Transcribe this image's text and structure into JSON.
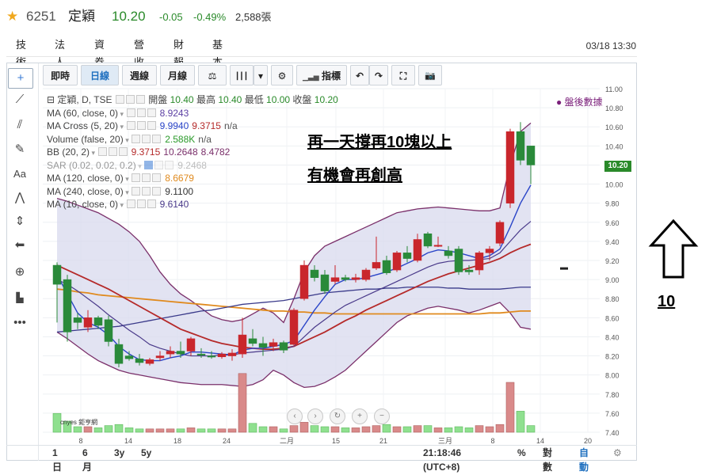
{
  "header": {
    "code": "6251",
    "name": "定穎",
    "price": "10.20",
    "change": "-0.05",
    "change_pct": "-0.49%",
    "volume": "2,588張",
    "star": "★"
  },
  "tabs": [
    "技術",
    "法人",
    "資券",
    "營收",
    "財報",
    "基本"
  ],
  "datetime": "03/18 13:30",
  "toolbar": {
    "items": [
      "即時",
      "日線",
      "週線",
      "月線",
      "⚖",
      "┃┃┃",
      "▾",
      "⚙",
      "指標",
      "↶",
      "↷",
      "⛶",
      "📷"
    ]
  },
  "legend": {
    "title": "定穎, D, TSE",
    "ohlc_open_label": "開盤",
    "ohlc_open": "10.40",
    "ohlc_high_label": "最高",
    "ohlc_high": "10.40",
    "ohlc_low_label": "最低",
    "ohlc_low": "10.00",
    "ohlc_close_label": "收盤",
    "ohlc_close": "10.20",
    "rows": [
      {
        "label": "MA (60, close, 0)",
        "values": [
          "8.9243"
        ],
        "colors": [
          "#5b3fa3"
        ]
      },
      {
        "label": "MA Cross (5, 20)",
        "values": [
          "9.9940",
          "9.3715",
          "n/a"
        ],
        "colors": [
          "#2a45c8",
          "#b52a2a",
          "#555555"
        ]
      },
      {
        "label": "Volume (false, 20)",
        "values": [
          "2.588K",
          "n/a"
        ],
        "colors": [
          "#2a9a2a",
          "#555555"
        ]
      },
      {
        "label": "BB (20, 2)",
        "values": [
          "9.3715",
          "10.2648",
          "8.4782"
        ],
        "colors": [
          "#b52a2a",
          "#7a2f6a",
          "#7a2f6a"
        ]
      },
      {
        "label": "SAR (0.02, 0.02, 0.2)",
        "values": [
          "9.2468"
        ],
        "colors": [
          "#888888"
        ]
      },
      {
        "label": "MA (120, close, 0)",
        "values": [
          "8.6679"
        ],
        "colors": [
          "#e08a1e"
        ]
      },
      {
        "label": "MA (240, close, 0)",
        "values": [
          "9.1100"
        ],
        "colors": [
          "#333333"
        ]
      },
      {
        "label": "MA (10, close, 0)",
        "values": [
          "9.6140"
        ],
        "colors": [
          "#4a3a8a"
        ]
      }
    ]
  },
  "after_hours": "盤後數據",
  "annotations": {
    "line1": "再一天撐再10塊以上",
    "line2": "有機會再創高",
    "arrow_label": "10"
  },
  "price_tag": "10.20",
  "bottom_bar": {
    "ranges": [
      "1日",
      "6月",
      "3y",
      "5y"
    ],
    "time": "21:18:46 (UTC+8)",
    "pct": "%",
    "log": "對數",
    "auto": "自動",
    "gear": "⚙"
  },
  "watermark": "cnyes 鉅亨網",
  "colors": {
    "up": "#c9262c",
    "down": "#2a8a3a",
    "bb_fill": "#d8daee",
    "bb_line": "#7a2f6a",
    "ma5": "#2a45c8",
    "ma20": "#b52a2a",
    "ma120": "#e08a1e",
    "ma60": "#3a3a8a",
    "vol_up": "#d98a8a",
    "vol_down": "#8fe08f"
  },
  "chart_data": {
    "type": "candlestick",
    "y_axis": {
      "ticks": [
        "11.00",
        "10.80",
        "10.60",
        "10.40",
        "10.20",
        "10.00",
        "9.80",
        "9.60",
        "9.40",
        "9.20",
        "9.00",
        "8.80",
        "8.60",
        "8.40",
        "8.20",
        "8.00",
        "7.80",
        "7.60",
        "7.40"
      ],
      "ylim": [
        7.4,
        11.0
      ]
    },
    "x_axis": {
      "ticks": [
        "8",
        "14",
        "18",
        "24",
        "二月",
        "15",
        "21",
        "三月",
        "8",
        "14",
        "20"
      ]
    },
    "candles": [
      {
        "o": 9.15,
        "h": 9.18,
        "l": 8.55,
        "c": 8.95
      },
      {
        "o": 9.0,
        "h": 9.05,
        "l": 8.35,
        "c": 8.45
      },
      {
        "o": 8.6,
        "h": 8.65,
        "l": 8.48,
        "c": 8.55
      },
      {
        "o": 8.5,
        "h": 8.68,
        "l": 8.45,
        "c": 8.6
      },
      {
        "o": 8.6,
        "h": 8.62,
        "l": 8.48,
        "c": 8.52
      },
      {
        "o": 8.58,
        "h": 8.62,
        "l": 8.3,
        "c": 8.35
      },
      {
        "o": 8.32,
        "h": 8.38,
        "l": 8.08,
        "c": 8.12
      },
      {
        "o": 8.2,
        "h": 8.25,
        "l": 8.15,
        "c": 8.17
      },
      {
        "o": 8.17,
        "h": 8.22,
        "l": 8.1,
        "c": 8.13
      },
      {
        "o": 8.12,
        "h": 8.18,
        "l": 8.1,
        "c": 8.16
      },
      {
        "o": 8.18,
        "h": 8.25,
        "l": 8.15,
        "c": 8.2
      },
      {
        "o": 8.22,
        "h": 8.3,
        "l": 8.18,
        "c": 8.25
      },
      {
        "o": 8.25,
        "h": 8.35,
        "l": 8.18,
        "c": 8.22
      },
      {
        "o": 8.25,
        "h": 8.4,
        "l": 8.2,
        "c": 8.38
      },
      {
        "o": 8.22,
        "h": 8.28,
        "l": 8.18,
        "c": 8.21
      },
      {
        "o": 8.2,
        "h": 8.25,
        "l": 8.17,
        "c": 8.19
      },
      {
        "o": 8.19,
        "h": 8.24,
        "l": 8.17,
        "c": 8.22
      },
      {
        "o": 8.2,
        "h": 8.27,
        "l": 8.15,
        "c": 8.23
      },
      {
        "o": 8.22,
        "h": 8.6,
        "l": 8.18,
        "c": 8.42
      },
      {
        "o": 8.38,
        "h": 8.48,
        "l": 8.3,
        "c": 8.33
      },
      {
        "o": 8.33,
        "h": 8.4,
        "l": 8.2,
        "c": 8.29
      },
      {
        "o": 8.3,
        "h": 8.38,
        "l": 8.25,
        "c": 8.34
      },
      {
        "o": 8.34,
        "h": 8.36,
        "l": 8.23,
        "c": 8.26
      },
      {
        "o": 8.32,
        "h": 8.7,
        "l": 8.3,
        "c": 8.68
      },
      {
        "o": 8.8,
        "h": 9.2,
        "l": 8.78,
        "c": 9.15
      },
      {
        "o": 9.1,
        "h": 9.15,
        "l": 8.98,
        "c": 9.02
      },
      {
        "o": 9.05,
        "h": 9.1,
        "l": 8.85,
        "c": 8.88
      },
      {
        "o": 8.98,
        "h": 9.15,
        "l": 8.95,
        "c": 9.02
      },
      {
        "o": 9.02,
        "h": 9.05,
        "l": 8.98,
        "c": 9.0
      },
      {
        "o": 9.0,
        "h": 9.06,
        "l": 8.97,
        "c": 9.02
      },
      {
        "o": 9.0,
        "h": 9.12,
        "l": 8.98,
        "c": 9.1
      },
      {
        "o": 9.12,
        "h": 9.45,
        "l": 9.1,
        "c": 9.18
      },
      {
        "o": 9.2,
        "h": 9.25,
        "l": 9.05,
        "c": 9.07
      },
      {
        "o": 9.1,
        "h": 9.3,
        "l": 9.08,
        "c": 9.28
      },
      {
        "o": 9.28,
        "h": 9.35,
        "l": 9.18,
        "c": 9.22
      },
      {
        "o": 9.2,
        "h": 9.48,
        "l": 9.18,
        "c": 9.42
      },
      {
        "o": 9.48,
        "h": 9.5,
        "l": 9.33,
        "c": 9.35
      },
      {
        "o": 9.35,
        "h": 9.45,
        "l": 9.34,
        "c": 9.36
      },
      {
        "o": 9.3,
        "h": 9.35,
        "l": 9.22,
        "c": 9.25
      },
      {
        "o": 9.32,
        "h": 9.35,
        "l": 9.05,
        "c": 9.08
      },
      {
        "o": 9.1,
        "h": 9.15,
        "l": 9.05,
        "c": 9.08
      },
      {
        "o": 9.1,
        "h": 9.3,
        "l": 9.05,
        "c": 9.28
      },
      {
        "o": 9.28,
        "h": 9.35,
        "l": 9.2,
        "c": 9.32
      },
      {
        "o": 9.38,
        "h": 9.62,
        "l": 9.35,
        "c": 9.6
      },
      {
        "o": 9.8,
        "h": 10.58,
        "l": 9.75,
        "c": 10.55
      },
      {
        "o": 10.55,
        "h": 10.65,
        "l": 10.2,
        "c": 10.25
      },
      {
        "o": 10.4,
        "h": 10.4,
        "l": 10.0,
        "c": 10.2
      }
    ],
    "volumes": [
      1.7,
      1.0,
      0.5,
      0.5,
      0.4,
      0.6,
      0.7,
      0.4,
      0.3,
      0.3,
      0.3,
      0.3,
      0.3,
      0.4,
      0.3,
      0.3,
      0.3,
      0.3,
      5.3,
      0.8,
      0.5,
      0.5,
      0.3,
      0.6,
      0.9,
      0.6,
      0.5,
      0.5,
      0.4,
      0.4,
      0.5,
      0.6,
      0.7,
      0.5,
      0.5,
      0.6,
      0.6,
      0.4,
      0.4,
      0.5,
      0.4,
      0.6,
      0.5,
      0.7,
      4.5,
      1.9,
      0.6
    ],
    "ma5": [
      9.05,
      8.85,
      8.65,
      8.55,
      8.5,
      8.42,
      8.3,
      8.22,
      8.16,
      8.15,
      8.15,
      8.18,
      8.2,
      8.24,
      8.24,
      8.23,
      8.22,
      8.21,
      8.26,
      8.28,
      8.28,
      8.3,
      8.32,
      8.36,
      8.52,
      8.68,
      8.82,
      8.95,
      9.0,
      9.0,
      9.02,
      9.05,
      9.08,
      9.12,
      9.17,
      9.22,
      9.28,
      9.31,
      9.3,
      9.28,
      9.25,
      9.22,
      9.25,
      9.32,
      9.55,
      9.8,
      9.99
    ],
    "ma20": [
      9.15,
      9.1,
      9.05,
      9.0,
      8.95,
      8.9,
      8.84,
      8.78,
      8.72,
      8.66,
      8.6,
      8.54,
      8.48,
      8.44,
      8.4,
      8.36,
      8.33,
      8.31,
      8.29,
      8.28,
      8.27,
      8.27,
      8.28,
      8.3,
      8.35,
      8.4,
      8.45,
      8.51,
      8.57,
      8.62,
      8.68,
      8.73,
      8.78,
      8.83,
      8.88,
      8.93,
      8.98,
      9.02,
      9.06,
      9.09,
      9.12,
      9.15,
      9.18,
      9.22,
      9.28,
      9.33,
      9.37
    ],
    "ma10": [
      9.0,
      8.95,
      8.88,
      8.8,
      8.72,
      8.63,
      8.55,
      8.47,
      8.4,
      8.32,
      8.28,
      8.25,
      8.22,
      8.2,
      8.2,
      8.2,
      8.21,
      8.21,
      8.23,
      8.24,
      8.25,
      8.26,
      8.27,
      8.3,
      8.4,
      8.5,
      8.58,
      8.66,
      8.73,
      8.78,
      8.83,
      8.88,
      8.93,
      8.98,
      9.03,
      9.08,
      9.13,
      9.17,
      9.19,
      9.2,
      9.2,
      9.21,
      9.22,
      9.28,
      9.4,
      9.52,
      9.61
    ],
    "ma60": [
      8.45,
      8.46,
      8.47,
      8.48,
      8.49,
      8.5,
      8.51,
      8.53,
      8.55,
      8.57,
      8.59,
      8.61,
      8.63,
      8.65,
      8.67,
      8.68,
      8.7,
      8.72,
      8.74,
      8.75,
      8.76,
      8.77,
      8.78,
      8.8,
      8.82,
      8.84,
      8.86,
      8.87,
      8.88,
      8.89,
      8.9,
      8.9,
      8.91,
      8.91,
      8.92,
      8.92,
      8.92,
      8.92,
      8.91,
      8.91,
      8.9,
      8.9,
      8.9,
      8.9,
      8.91,
      8.92,
      8.92
    ],
    "ma120": [
      8.9,
      8.89,
      8.87,
      8.86,
      8.84,
      8.83,
      8.82,
      8.81,
      8.8,
      8.79,
      8.78,
      8.77,
      8.76,
      8.75,
      8.74,
      8.73,
      8.72,
      8.71,
      8.7,
      8.69,
      8.68,
      8.67,
      8.67,
      8.66,
      8.66,
      8.65,
      8.65,
      8.64,
      8.64,
      8.64,
      8.64,
      8.64,
      8.64,
      8.64,
      8.64,
      8.64,
      8.64,
      8.64,
      8.64,
      8.64,
      8.64,
      8.64,
      8.65,
      8.65,
      8.66,
      8.67,
      8.67
    ],
    "bb_upper": [
      9.85,
      9.82,
      9.78,
      9.74,
      9.7,
      9.64,
      9.58,
      9.5,
      9.4,
      9.25,
      9.08,
      8.95,
      8.85,
      8.78,
      8.7,
      8.62,
      8.58,
      8.56,
      8.58,
      8.64,
      8.7,
      8.65,
      8.55,
      8.8,
      9.08,
      9.25,
      9.35,
      9.4,
      9.45,
      9.5,
      9.55,
      9.6,
      9.65,
      9.7,
      9.72,
      9.74,
      9.75,
      9.76,
      9.75,
      9.74,
      9.73,
      9.72,
      9.72,
      9.75,
      10.2,
      10.55,
      10.64
    ],
    "bb_lower": [
      8.45,
      8.38,
      8.3,
      8.22,
      8.15,
      8.1,
      8.05,
      8.02,
      8.0,
      7.98,
      7.96,
      7.94,
      7.92,
      7.91,
      7.9,
      7.9,
      7.9,
      7.89,
      7.88,
      7.9,
      7.95,
      8.05,
      8.0,
      7.92,
      7.87,
      7.88,
      7.92,
      7.98,
      8.05,
      8.15,
      8.25,
      8.35,
      8.45,
      8.55,
      8.62,
      8.66,
      8.7,
      8.72,
      8.7,
      8.68,
      8.65,
      8.68,
      8.72,
      8.76,
      8.65,
      8.5,
      8.48
    ]
  }
}
